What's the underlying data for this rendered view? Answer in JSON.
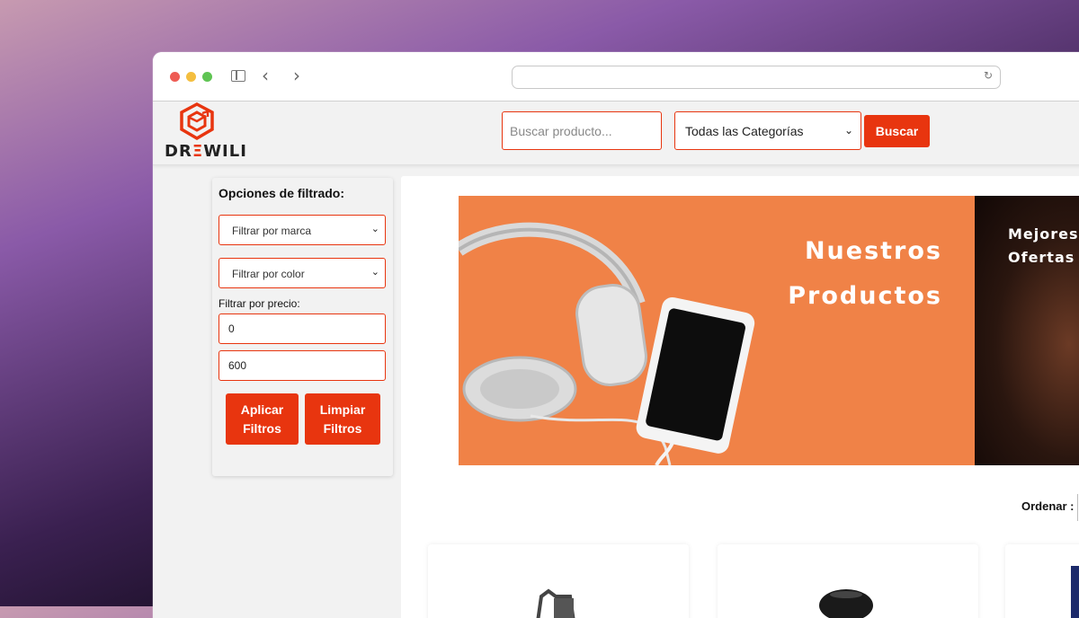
{
  "header": {
    "logo": {
      "text_main": "DR",
      "text_accent": "Ξ",
      "text_tail": "WILI",
      "accent": "#e8350f"
    },
    "search": {
      "placeholder": "Buscar producto..."
    },
    "category_select": {
      "selected": "Todas las Categorías"
    },
    "search_button": "Buscar"
  },
  "filters": {
    "title": "Opciones de filtrado:",
    "brand_select": "Filtrar por marca",
    "color_select": "Filtrar por color",
    "price_label": "Filtrar por precio:",
    "price_min": "0",
    "price_max": "600",
    "apply_button": "Aplicar Filtros",
    "clear_button": "Limpiar Filtros"
  },
  "banner": {
    "line1": "Nuestros",
    "line2": "Productos",
    "next_line1": "Mejores",
    "next_line2": "Ofertas"
  },
  "sort": {
    "label": "Ordenar :"
  },
  "colors": {
    "brand": "#e8350f",
    "banner": "#f08247"
  }
}
